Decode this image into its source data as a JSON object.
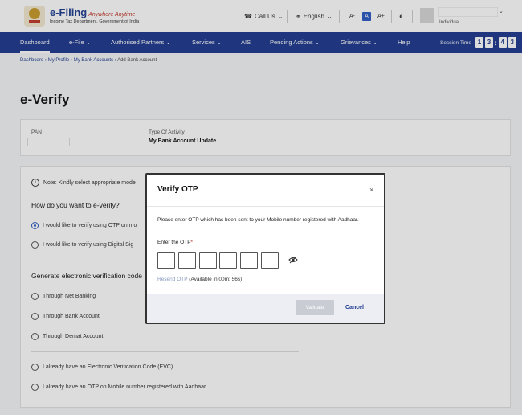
{
  "header": {
    "brand_name": "e-Filing",
    "brand_tagline": "Anywhere Anytime",
    "brand_subtitle": "Income Tax Department, Government of India",
    "call_us": "Call Us",
    "language": "English",
    "font_sizes": [
      "A-",
      "A",
      "A+"
    ],
    "user_role": "Individual"
  },
  "nav": {
    "items": [
      {
        "label": "Dashboard"
      },
      {
        "label": "e-File"
      },
      {
        "label": "Authorised Partners"
      },
      {
        "label": "Services"
      },
      {
        "label": "AIS"
      },
      {
        "label": "Pending Actions"
      },
      {
        "label": "Grievances"
      },
      {
        "label": "Help"
      }
    ],
    "session_label": "Session Time",
    "session_digits": [
      "1",
      "3",
      ":",
      "4",
      "3"
    ]
  },
  "breadcrumb": {
    "items": [
      "Dashboard",
      "My Profile",
      "My Bank Accounts"
    ],
    "current": "Add Bank Account"
  },
  "page": {
    "title": "e-Verify",
    "pan_label": "PAN",
    "activity_label": "Type Of Activity",
    "activity_value": "My Bank Account Update",
    "note": "Note: Kindly select appropriate mode",
    "question": "How do you want to e-verify?",
    "options": [
      "I would like to verify using OTP on mo",
      "I would like to verify using Digital Sig"
    ],
    "generate_title": "Generate electronic verification code",
    "generate_options": [
      "Through Net Banking",
      "Through Bank Account",
      "Through Demat Account"
    ],
    "bottom_options": [
      "I already have an Electronic Verification Code (EVC)",
      "I already have an OTP on Mobile number registered with Aadhaar"
    ]
  },
  "modal": {
    "title": "Verify OTP",
    "close": "×",
    "message": "Please enter OTP which has been sent to your Mobile number registered with Aadhaar.",
    "otp_label": "Enter the OTP",
    "otp_required_mark": "*",
    "otp_values": [
      "",
      "",
      "",
      "",
      "",
      ""
    ],
    "resend_link": "Resend OTP",
    "resend_timer": "(Available in  00m: 56s)",
    "validate_label": "Validate",
    "cancel_label": "Cancel"
  },
  "colors": {
    "nav_bg": "#1e3a8f",
    "accent": "#2b59c3",
    "validate_disabled": "#c9ccd3"
  }
}
